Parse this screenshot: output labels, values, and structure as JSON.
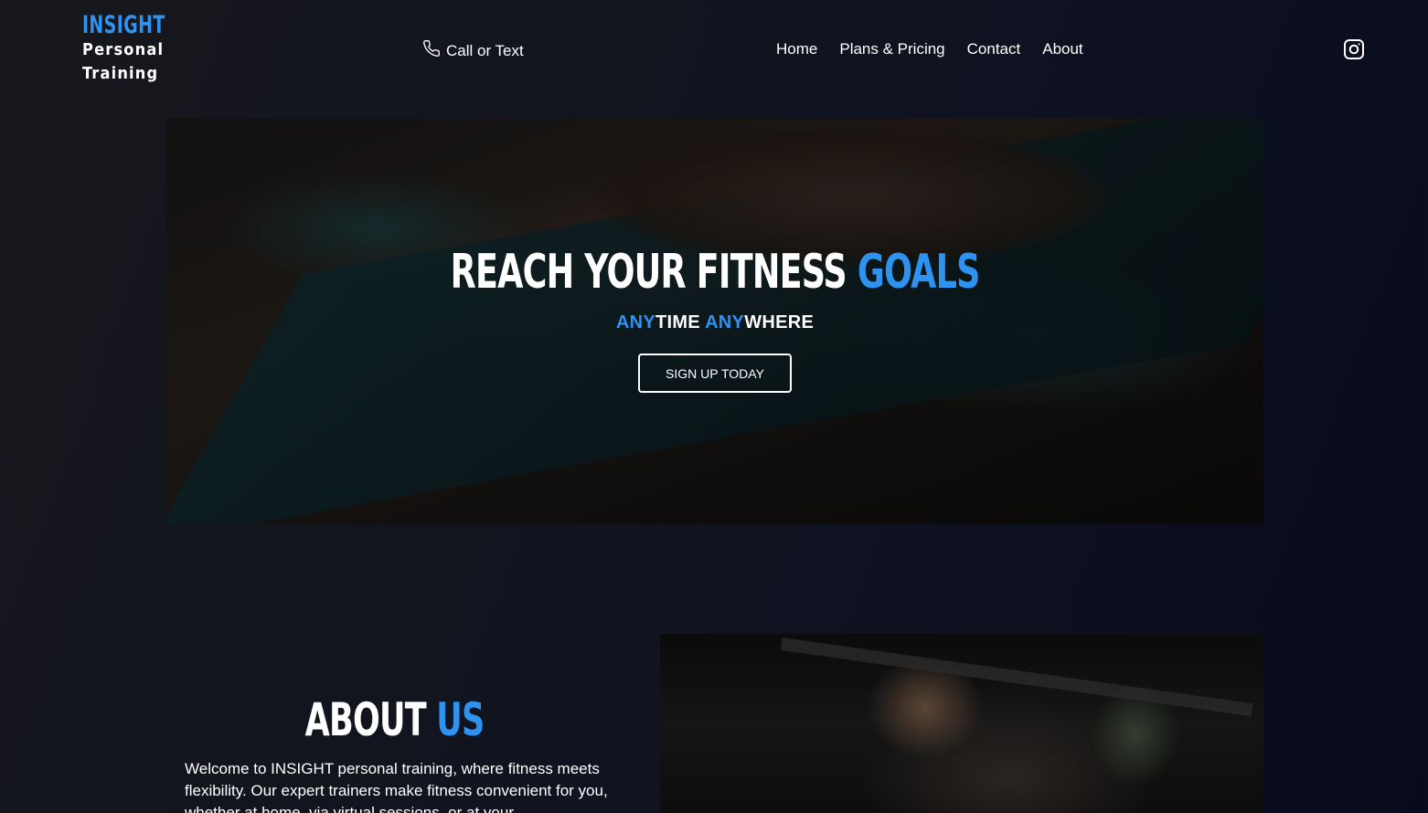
{
  "header": {
    "logo": {
      "brand": "INSIGHT",
      "line1": "Personal",
      "line2": "Training"
    },
    "call_label": "Call or Text",
    "nav": [
      {
        "label": "Home"
      },
      {
        "label": "Plans & Pricing"
      },
      {
        "label": "Contact"
      },
      {
        "label": "About"
      }
    ],
    "social_icon": "instagram-icon"
  },
  "hero": {
    "title_main": "REACH YOUR FITNESS ",
    "title_accent": "GOALS",
    "sub_any1": "ANY",
    "sub_time": "TIME ",
    "sub_any2": "ANY",
    "sub_where": "WHERE",
    "cta_label": "SIGN UP TODAY"
  },
  "about": {
    "title_main": "ABOUT ",
    "title_accent": "US",
    "text": "Welcome to INSIGHT personal training, where fitness meets flexibility. Our expert trainers make fitness convenient for you, whether at home, via virtual sessions, or at your"
  },
  "colors": {
    "accent": "#2e93f0",
    "background": "#0f1220",
    "text": "#ffffff"
  }
}
